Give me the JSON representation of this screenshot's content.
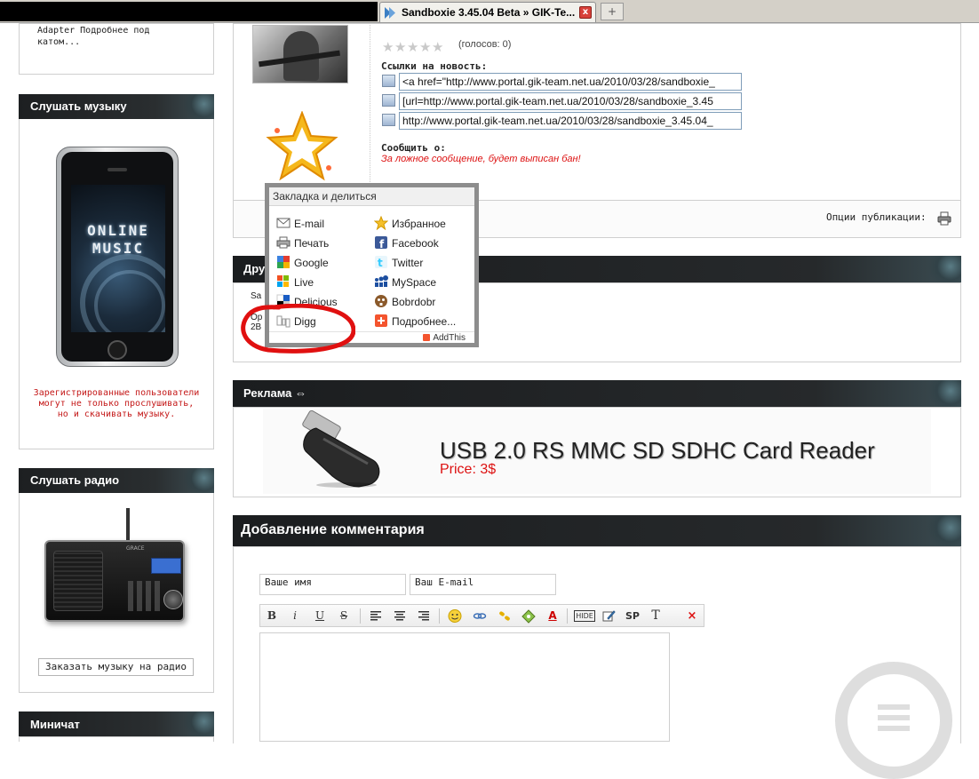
{
  "browser": {
    "tab_title": "Sandboxie 3.45.04 Beta » GIK-Te...",
    "tab_close": "x",
    "new_tab": "+"
  },
  "sidebar": {
    "box1_text": "Adapter Подробнее под катом...",
    "music": {
      "title": "Слушать музыку",
      "screen_line1": "ONLINE",
      "screen_line2": "MUSIC",
      "note": "Зарегистрированные пользователи могут не только прослушивать, но и скачивать музыку."
    },
    "radio": {
      "title": "Слушать радио",
      "brand": "GRACE",
      "order_button": "Заказать музыку на радио"
    },
    "minichat": {
      "title": "Миничат"
    }
  },
  "article": {
    "votes": "(голосов: 0)",
    "links_title": "Ссылки на новость:",
    "links": [
      "<a href=\"http://www.portal.gik-team.net.ua/2010/03/28/sandboxie_",
      "[url=http://www.portal.gik-team.net.ua/2010/03/28/sandboxie_3.45",
      "http://www.portal.gik-team.net.ua/2010/03/28/sandboxie_3.45.04_"
    ],
    "report_title": "Сообщить о:",
    "report_note": "За ложное сообщение, будет выписан бан!",
    "pub_options": "Опции публикации:"
  },
  "related": {
    "title": "Дру",
    "frag1": "Sa",
    "frag2": "Op",
    "frag3": "2B"
  },
  "share_popup": {
    "header": "Закладка и делиться",
    "left_items": [
      "E-mail",
      "Печать",
      "Google",
      "Live",
      "Delicious",
      "Digg"
    ],
    "right_items": [
      "Избранное",
      "Facebook",
      "Twitter",
      "MySpace",
      "Bobrdobr",
      "Подробнее..."
    ],
    "footer": "AddThis"
  },
  "ad": {
    "title": "Реклама ⇔",
    "product": "USB 2.0 RS MMC SD SDHC Card Reader",
    "price": "Price: 3$"
  },
  "comment": {
    "title": "Добавление комментария",
    "name_placeholder": "Ваше имя",
    "email_placeholder": "Ваш E-mail",
    "toolbar": {
      "bold": "B",
      "italic": "i",
      "underline": "U",
      "strike": "S",
      "hide": "HIDE",
      "sp": "SP",
      "t": "T",
      "close": "×"
    }
  },
  "colors": {
    "dark_header": "#1b1d1f",
    "accent_red": "#d11111",
    "annotation_red": "#e01010"
  }
}
